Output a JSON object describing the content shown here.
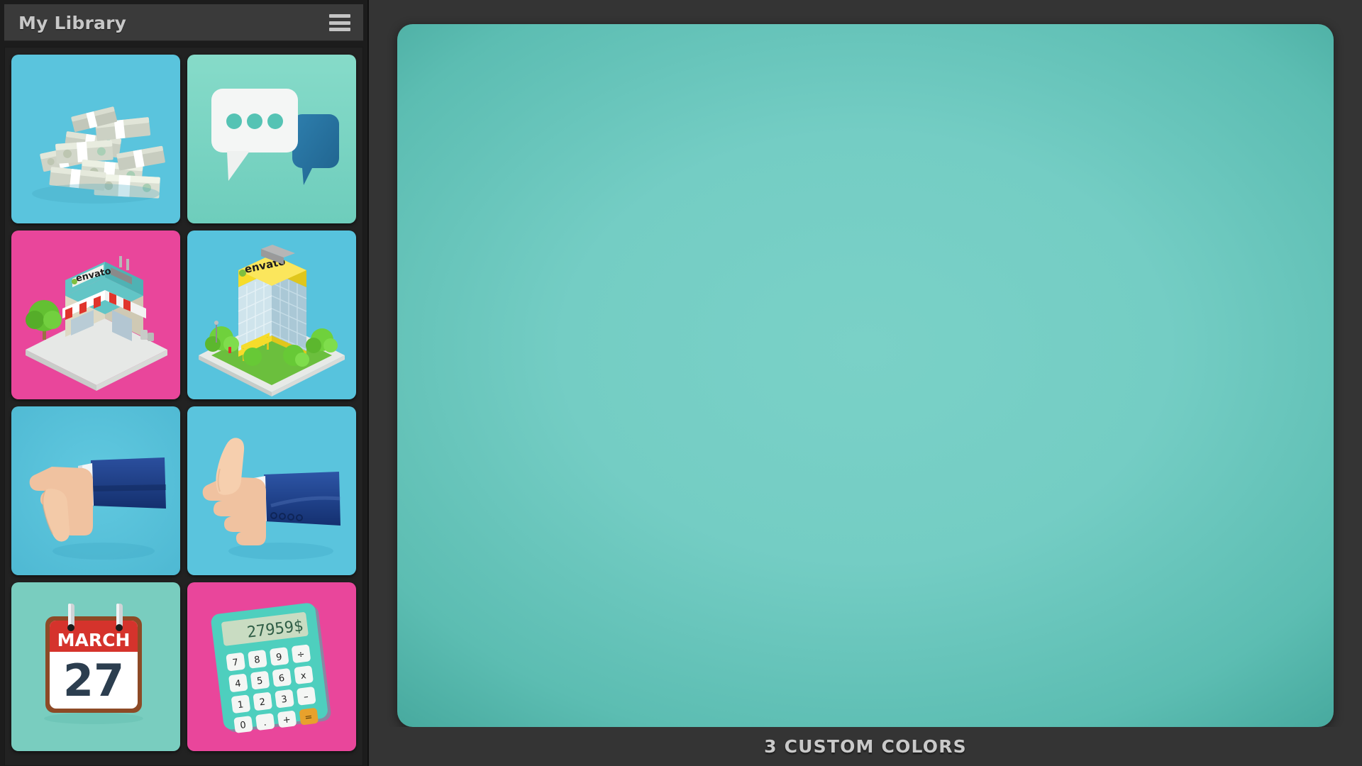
{
  "sidebar": {
    "title": "My Library",
    "menu_icon": "hamburger-menu-icon",
    "items": [
      {
        "name": "money-stacks",
        "label": "Money Stacks",
        "bg": "#5ac4dd",
        "accent": "#6fd0e0"
      },
      {
        "name": "chat-bubbles",
        "label": "Chat Bubbles",
        "bg": "#7fd6c5",
        "accent": "#2b7fb0"
      },
      {
        "name": "envato-store",
        "label": "Envato Store",
        "bg": "#e9469b",
        "accent": "#63c8c6",
        "brand_text": "envato"
      },
      {
        "name": "envato-office-building",
        "label": "Envato Office Building",
        "bg": "#57c3dd",
        "accent": "#f2d423",
        "brand_text": "envato"
      },
      {
        "name": "thumbs-down-hand",
        "label": "Thumbs Down",
        "bg": "#5ac4dd",
        "accent": "#1f3f7f"
      },
      {
        "name": "thumbs-up-hand",
        "label": "Thumbs Up",
        "bg": "#5ac4dd",
        "accent": "#1f3f7f"
      },
      {
        "name": "calendar-march-27",
        "label": "Calendar",
        "bg": "#79cdbf",
        "accent": "#d5332c",
        "month": "MARCH",
        "day": "27"
      },
      {
        "name": "calculator",
        "label": "Calculator",
        "bg": "#e9469b",
        "accent": "#4ecfbe",
        "display_value": "27959$"
      }
    ]
  },
  "main": {
    "canvas_color_center": "#7ad1c7",
    "canvas_color_edge": "#3b9e93",
    "footer_label": "3 CUSTOM COLORS"
  }
}
